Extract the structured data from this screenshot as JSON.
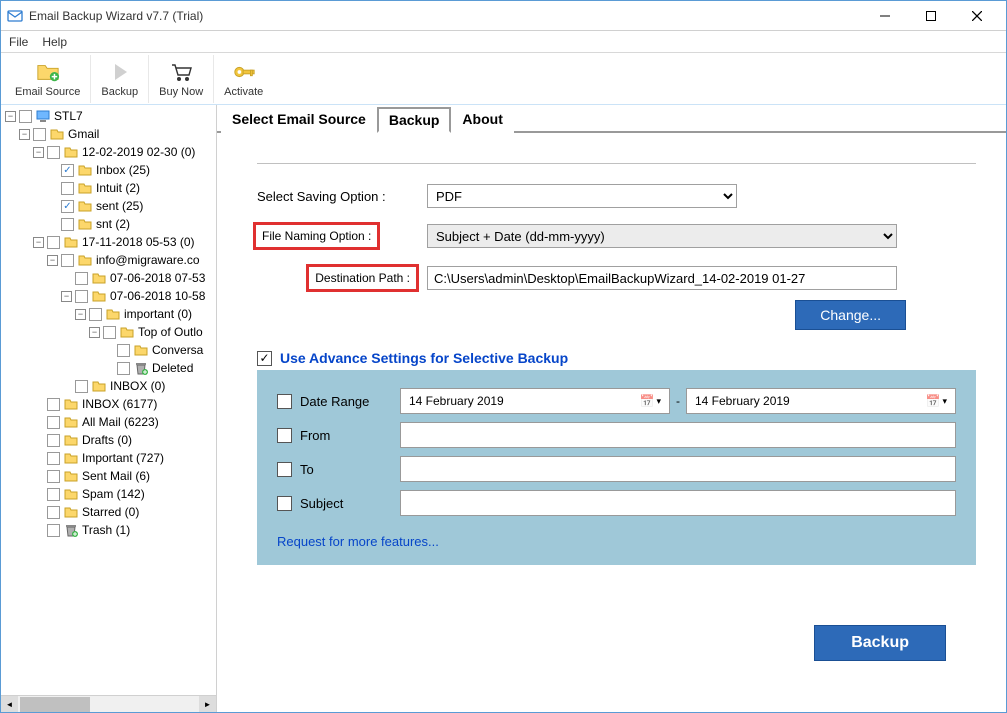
{
  "window": {
    "title": "Email Backup Wizard v7.7 (Trial)"
  },
  "menu": {
    "file": "File",
    "help": "Help"
  },
  "toolbar": {
    "emailSource": "Email Source",
    "backup": "Backup",
    "buyNow": "Buy Now",
    "activate": "Activate"
  },
  "tree": [
    {
      "indent": 0,
      "exp": "-",
      "chk": 0,
      "icon": "pc",
      "label": "STL7"
    },
    {
      "indent": 1,
      "exp": "-",
      "chk": 0,
      "icon": "gmail",
      "label": "Gmail"
    },
    {
      "indent": 2,
      "exp": "-",
      "chk": 0,
      "icon": "folder",
      "label": "12-02-2019 02-30 (0)"
    },
    {
      "indent": 3,
      "exp": "",
      "chk": 1,
      "icon": "folder",
      "label": "Inbox (25)"
    },
    {
      "indent": 3,
      "exp": "",
      "chk": 0,
      "icon": "folder",
      "label": "Intuit (2)"
    },
    {
      "indent": 3,
      "exp": "",
      "chk": 1,
      "icon": "folder",
      "label": "sent (25)"
    },
    {
      "indent": 3,
      "exp": "",
      "chk": 0,
      "icon": "folder",
      "label": "snt (2)"
    },
    {
      "indent": 2,
      "exp": "-",
      "chk": 0,
      "icon": "folder",
      "label": "17-11-2018 05-53 (0)"
    },
    {
      "indent": 3,
      "exp": "-",
      "chk": 0,
      "icon": "folder",
      "label": "info@migraware.co"
    },
    {
      "indent": 4,
      "exp": "",
      "chk": 0,
      "icon": "folder",
      "label": "07-06-2018 07-53"
    },
    {
      "indent": 4,
      "exp": "-",
      "chk": 0,
      "icon": "folder",
      "label": "07-06-2018 10-58"
    },
    {
      "indent": 5,
      "exp": "-",
      "chk": 0,
      "icon": "folder",
      "label": "important (0)"
    },
    {
      "indent": 6,
      "exp": "-",
      "chk": 0,
      "icon": "folder",
      "label": "Top of Outlo"
    },
    {
      "indent": 7,
      "exp": "",
      "chk": 0,
      "icon": "folder",
      "label": "Conversa"
    },
    {
      "indent": 7,
      "exp": "",
      "chk": 0,
      "icon": "trash",
      "label": "Deleted"
    },
    {
      "indent": 4,
      "exp": "",
      "chk": 0,
      "icon": "folder",
      "label": "INBOX (0)"
    },
    {
      "indent": 2,
      "exp": "",
      "chk": 0,
      "icon": "folder",
      "label": "INBOX (6177)"
    },
    {
      "indent": 2,
      "exp": "",
      "chk": 0,
      "icon": "folder",
      "label": "All Mail (6223)"
    },
    {
      "indent": 2,
      "exp": "",
      "chk": 0,
      "icon": "folder",
      "label": "Drafts (0)"
    },
    {
      "indent": 2,
      "exp": "",
      "chk": 0,
      "icon": "folder",
      "label": "Important (727)"
    },
    {
      "indent": 2,
      "exp": "",
      "chk": 0,
      "icon": "folder",
      "label": "Sent Mail (6)"
    },
    {
      "indent": 2,
      "exp": "",
      "chk": 0,
      "icon": "folder",
      "label": "Spam (142)"
    },
    {
      "indent": 2,
      "exp": "",
      "chk": 0,
      "icon": "folder",
      "label": "Starred (0)"
    },
    {
      "indent": 2,
      "exp": "",
      "chk": 0,
      "icon": "trash",
      "label": "Trash (1)"
    }
  ],
  "tabs": {
    "source": "Select Email Source",
    "backup": "Backup",
    "about": "About"
  },
  "form": {
    "savingLabel": "Select Saving Option  :",
    "savingValue": "PDF",
    "namingLabel": "File Naming Option  :",
    "namingValue": "Subject + Date (dd-mm-yyyy)",
    "destLabel": "Destination Path  :",
    "destValue": "C:\\Users\\admin\\Desktop\\EmailBackupWizard_14-02-2019 01-27",
    "changeBtn": "Change..."
  },
  "advance": {
    "title": "Use Advance Settings for Selective Backup",
    "dateRange": "Date Range",
    "dateFrom": "14  February  2019",
    "dateTo": "14  February  2019",
    "from": "From",
    "to": "To",
    "subject": "Subject",
    "requestLink": "Request for more features..."
  },
  "backupBtn": "Backup"
}
